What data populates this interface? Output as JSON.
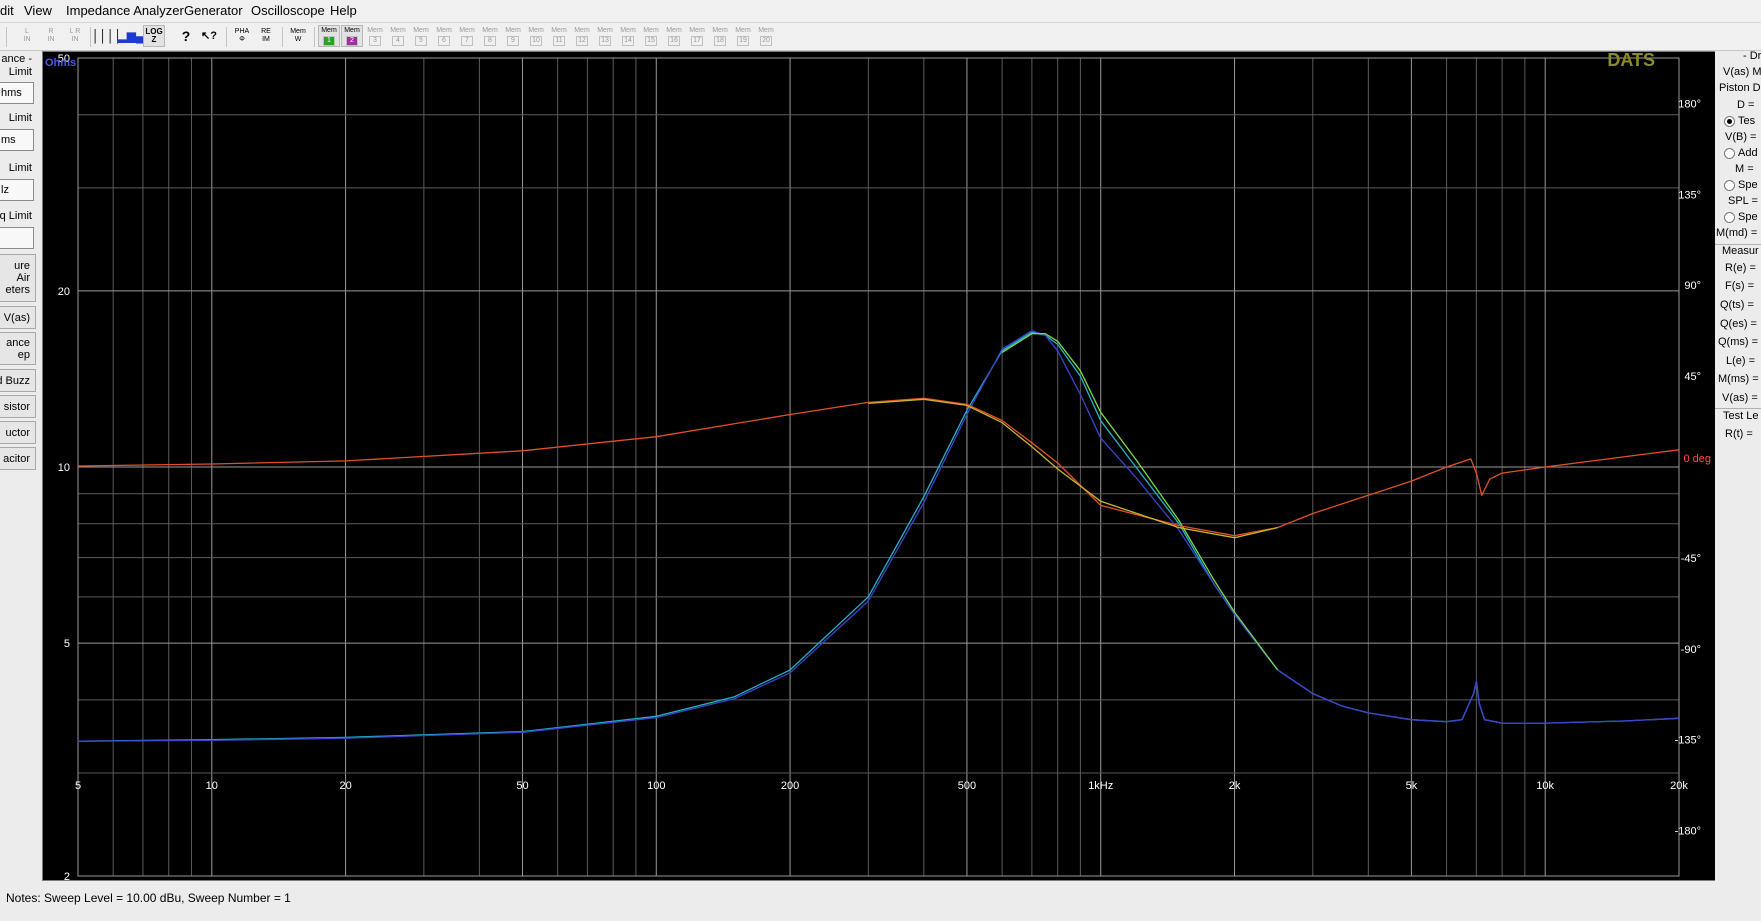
{
  "menu": {
    "items": [
      "dit",
      "View",
      "Impedance Analyzer",
      "Generator",
      "Oscilloscope",
      "Help"
    ]
  },
  "toolbar": {
    "buttons": [
      {
        "name": "l-in-icon",
        "label": "L\nIN"
      },
      {
        "name": "r-in-icon",
        "label": "R\nIN"
      },
      {
        "name": "lr-in-icon",
        "label": "L R\nIN"
      },
      {
        "name": "bars-icon",
        "label": "││││"
      },
      {
        "name": "histogram-icon",
        "label": "▂▆▄"
      },
      {
        "name": "log-z-icon",
        "label": "LOG\nZ"
      },
      {
        "name": "question-mark-icon",
        "label": "?"
      },
      {
        "name": "context-help-icon",
        "label": "↖?"
      },
      {
        "name": "pha-phi-icon",
        "label": "PHA\nΦ"
      },
      {
        "name": "re-im-icon",
        "label": "RE\nIM"
      },
      {
        "name": "mem-w-icon",
        "label": "Mem\nW"
      }
    ],
    "mem_label": "Mem",
    "mem_slots": [
      "1",
      "2",
      "3",
      "4",
      "5",
      "6",
      "7",
      "8",
      "9",
      "10",
      "11",
      "12",
      "13",
      "14",
      "15",
      "16",
      "17",
      "18",
      "19",
      "20"
    ],
    "mem_slot_colors": [
      "#2aa02a",
      "#a030a0"
    ]
  },
  "left_panel": {
    "group1_label": "ance -\nLimit",
    "group1_field": "hms",
    "group2_label": "Limit",
    "group2_field": "ms",
    "group3_label": "Limit",
    "group3_field": "lz",
    "group4_label": "q Limit",
    "group4_field": "",
    "buttons": [
      "ure\nAir\neters",
      "e V(as)",
      "ance\nep",
      "d Buzz",
      "sistor",
      "uctor",
      "acitor"
    ]
  },
  "plot": {
    "unit_left": "Ohms",
    "unit_right": "0 deg",
    "logo": "DATS",
    "y_ticks_left": [
      "50",
      "20",
      "10",
      "5",
      "2"
    ],
    "y_ticks_right": [
      "180°",
      "135°",
      "90°",
      "45°",
      "-45°",
      "-90°",
      "-135°",
      "-180°"
    ],
    "x_ticks": [
      "5",
      "10",
      "20",
      "50",
      "100",
      "200",
      "500",
      "1kHz",
      "2k",
      "5k",
      "10k",
      "20k"
    ],
    "colors": {
      "unit_left": "#4a5ad8",
      "unit_right": "#ff4a4a",
      "logo": "#8a8a28",
      "grid": "#5a5a5a",
      "grid_major": "#9a9a9a"
    }
  },
  "chart_data": {
    "type": "line",
    "title": "",
    "xlabel": "",
    "ylabel": "Ohms",
    "y2label": "deg",
    "x_scale": "log",
    "y_scale": "log",
    "xlim": [
      5,
      20000
    ],
    "ylim": [
      2,
      50
    ],
    "y2lim": [
      -202.5,
      202.5
    ],
    "grid": true,
    "series": [
      {
        "axis": "left",
        "color": "#20b4c8",
        "x": [
          5,
          10,
          20,
          50,
          100,
          150,
          200,
          300,
          400,
          500,
          600,
          700,
          750,
          800,
          900,
          1000,
          1200,
          1500,
          1800,
          2000,
          2500,
          3000,
          3500,
          4000,
          5000,
          6000,
          6500,
          6900,
          7000,
          7100,
          7300,
          8000,
          10000,
          15000,
          20000
        ],
        "y": [
          3.4,
          3.42,
          3.45,
          3.53,
          3.75,
          4.05,
          4.5,
          6.0,
          8.9,
          12.5,
          15.8,
          17.0,
          16.8,
          16.2,
          14.3,
          12.0,
          10.0,
          8.0,
          6.3,
          5.6,
          4.5,
          4.1,
          3.9,
          3.8,
          3.7,
          3.67,
          3.7,
          4.1,
          4.3,
          3.95,
          3.7,
          3.65,
          3.65,
          3.68,
          3.72
        ]
      },
      {
        "axis": "left",
        "color": "#3a44cc",
        "x": [
          5,
          10,
          20,
          50,
          100,
          150,
          200,
          300,
          400,
          500,
          600,
          700,
          750,
          800,
          900,
          1000,
          1200,
          1500,
          1800,
          2000,
          2500,
          3000,
          3500,
          4000,
          5000,
          6000,
          6500,
          6900,
          7000,
          7100,
          7300,
          8000,
          10000,
          15000,
          20000
        ],
        "y": [
          3.4,
          3.41,
          3.44,
          3.52,
          3.73,
          4.02,
          4.45,
          5.9,
          8.7,
          12.3,
          15.9,
          17.1,
          16.8,
          15.8,
          13.3,
          11.2,
          9.6,
          7.8,
          6.3,
          5.6,
          4.5,
          4.1,
          3.9,
          3.8,
          3.7,
          3.67,
          3.7,
          4.1,
          4.3,
          3.95,
          3.7,
          3.65,
          3.65,
          3.68,
          3.72
        ]
      },
      {
        "axis": "left",
        "color": "#7ad848",
        "x": [
          600,
          700,
          750,
          800,
          900,
          1000,
          1200,
          1500,
          1800,
          2000,
          2500
        ],
        "y": [
          15.7,
          16.9,
          16.9,
          16.4,
          14.6,
          12.4,
          10.3,
          8.1,
          6.4,
          5.65,
          4.5
        ]
      },
      {
        "axis": "right",
        "color": "#e05028",
        "x": [
          5,
          10,
          20,
          50,
          100,
          200,
          300,
          400,
          500,
          600,
          700,
          800,
          1000,
          1500,
          2000,
          2500,
          3000,
          4000,
          5000,
          6000,
          6800,
          7000,
          7200,
          7500,
          8000,
          10000,
          15000,
          20000
        ],
        "y": [
          0.5,
          1.5,
          3,
          8,
          15,
          26,
          32,
          34,
          31,
          23,
          12,
          2,
          -19,
          -29,
          -34,
          -30,
          -23,
          -14,
          -7,
          0,
          4,
          -3,
          -14,
          -6,
          -3,
          0,
          5,
          8.5
        ]
      },
      {
        "axis": "right",
        "color": "#c8b428",
        "x": [
          300,
          400,
          500,
          600,
          700,
          800,
          1000,
          1500,
          2000,
          2500
        ],
        "y": [
          31.5,
          33.5,
          30.5,
          22,
          10,
          -1,
          -17,
          -30,
          -35,
          -30
        ]
      }
    ]
  },
  "right_panel": {
    "title": "- Dr",
    "rows": [
      "V(as) M",
      "Piston D",
      "D =",
      "Tes",
      "V(B) =",
      "Add",
      "M =",
      "Spe",
      "SPL =",
      "Spe",
      "M(md) ="
    ],
    "measure_title": "Measur",
    "measure_rows": [
      "R(e) =",
      "F(s) =",
      "Q(ts) =",
      "Q(es) =",
      "Q(ms) =",
      "L(e) =",
      "M(ms) =",
      "V(as) ="
    ],
    "test_level_title": "Test Le",
    "test_level_rows": [
      "R(t) ="
    ]
  },
  "status": {
    "notes": "Notes:  Sweep Level = 10.00 dBu,   Sweep Number =     1"
  }
}
